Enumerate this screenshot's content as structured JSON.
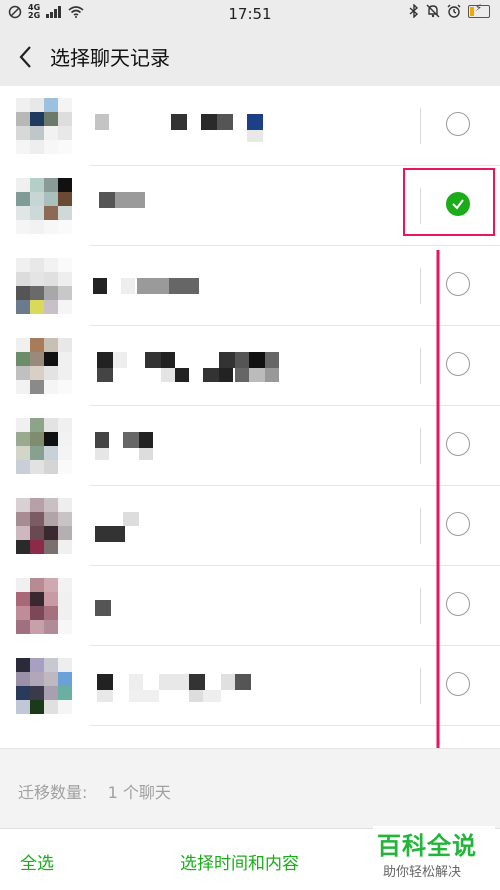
{
  "status_bar": {
    "time": "17:51",
    "network_top": "4G",
    "network_bottom": "2G",
    "icons": [
      "no-disturb-icon",
      "signal-icon",
      "wifi-icon",
      "bluetooth-icon",
      "bell-off-icon",
      "alarm-icon",
      "battery-charging-icon"
    ]
  },
  "header": {
    "back_icon": "chevron-left-icon",
    "title": "选择聊天记录"
  },
  "chats": [
    {
      "selected": false
    },
    {
      "selected": true
    },
    {
      "selected": false
    },
    {
      "selected": false
    },
    {
      "selected": false
    },
    {
      "selected": false
    },
    {
      "selected": false
    },
    {
      "selected": false
    }
  ],
  "summary": {
    "label": "迁移数量:",
    "value": "1 个聊天"
  },
  "footer": {
    "select_all": "全选",
    "select_time_content": "选择时间和内容"
  },
  "watermark": {
    "title": "百科全说",
    "subtitle": "助你轻松解决"
  },
  "colors": {
    "accent": "#1aad19",
    "annotation": "#e8175d",
    "watermark": "#22b53a"
  }
}
